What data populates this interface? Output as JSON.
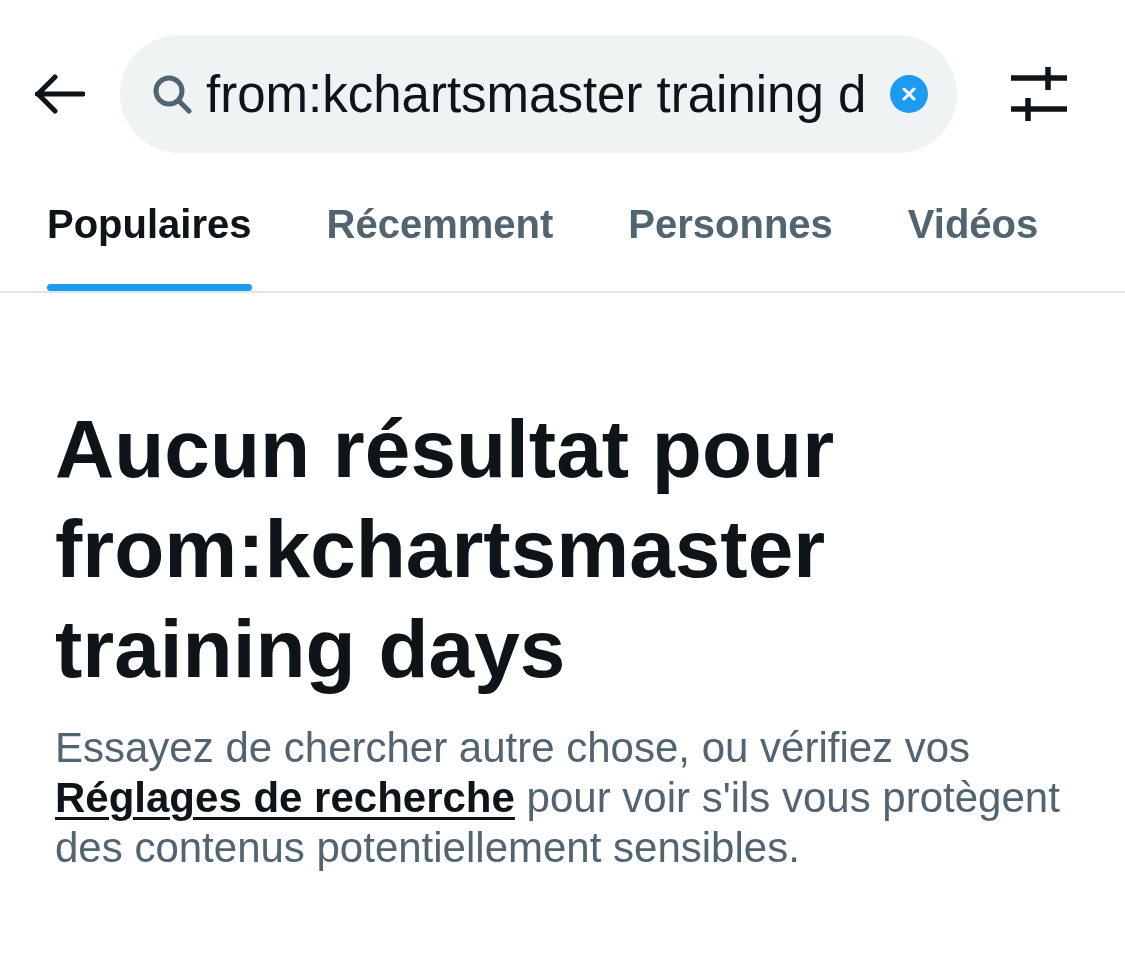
{
  "search": {
    "value": "from:kchartsmaster training d"
  },
  "tabs": [
    {
      "label": "Populaires",
      "selected": true
    },
    {
      "label": "Récemment",
      "selected": false
    },
    {
      "label": "Personnes",
      "selected": false
    },
    {
      "label": "Vidéos",
      "selected": false
    }
  ],
  "empty_state": {
    "title": "Aucun résultat pour from:kchartsmaster training days",
    "message": {
      "before": "Essayez de chercher autre chose, ou vérifiez vos",
      "link": "Réglages de recherche",
      "after": "pour voir s'ils vous protègent des contenus potentiellement sensibles."
    }
  }
}
